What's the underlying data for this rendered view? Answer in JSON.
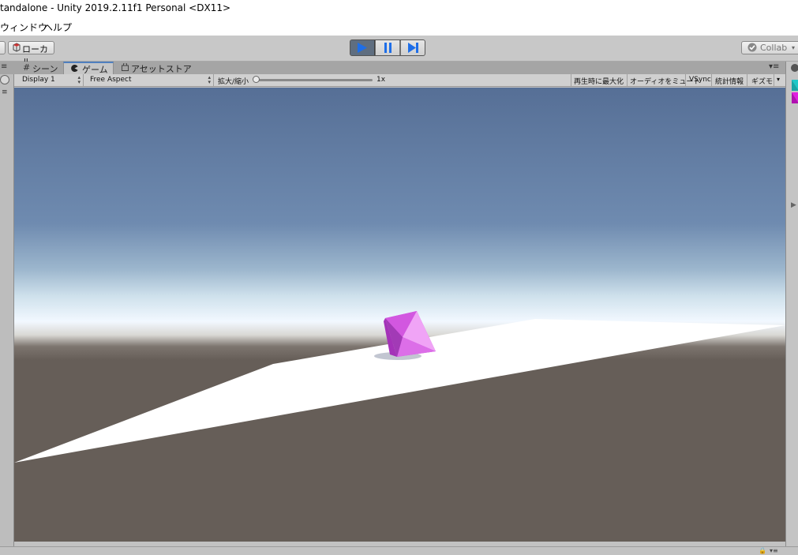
{
  "window": {
    "title": "tandalone - Unity 2019.2.11f1 Personal <DX11>"
  },
  "menu": {
    "items": [
      "ウィンドウ",
      "ヘルプ"
    ]
  },
  "toolbar": {
    "local_label": "ローカル",
    "collab_label": "Collab",
    "play_state": "playing"
  },
  "tabs": [
    {
      "label": "シーン",
      "icon": "scene-grid-icon"
    },
    {
      "label": "ゲーム",
      "icon": "game-pacman-icon",
      "active": true
    },
    {
      "label": "アセットストア",
      "icon": "store-bag-icon"
    }
  ],
  "game_bar": {
    "display": "Display 1",
    "aspect": "Free Aspect",
    "scale_label": "拡大/縮小",
    "scale_value": "1x",
    "scale_fraction": 0.0,
    "maximize": "再生時に最大化",
    "mute": "オーディオをミュート",
    "vsync": "VSync",
    "stats": "統計情報",
    "gizmos": "ギズモ"
  },
  "colors": {
    "sky_top": "#566f96",
    "horizon": "#f2f8ff",
    "ground": "#665e58",
    "plane": "#ffffff",
    "cube_magenta": "#c844d8",
    "play_active": "#5f6e80",
    "accent_blue": "#1e6ee8"
  }
}
